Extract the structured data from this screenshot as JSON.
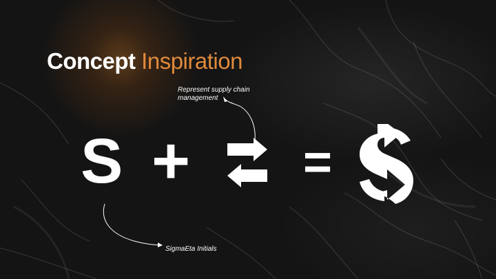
{
  "slide": {
    "title_part1": "Concept",
    "title_part2": "Inspiration",
    "note_top": "Represent supply chain management",
    "note_bottom": "SigmaEta Initials",
    "letter": "S",
    "plus": "+",
    "equals": "=",
    "accent_color": "#e08a3c",
    "text_color": "#ffffff",
    "background_color": "#141414"
  },
  "icons": {
    "swap": "two-opposing-arrows-icon",
    "logo": "s-arrow-logo-icon"
  }
}
